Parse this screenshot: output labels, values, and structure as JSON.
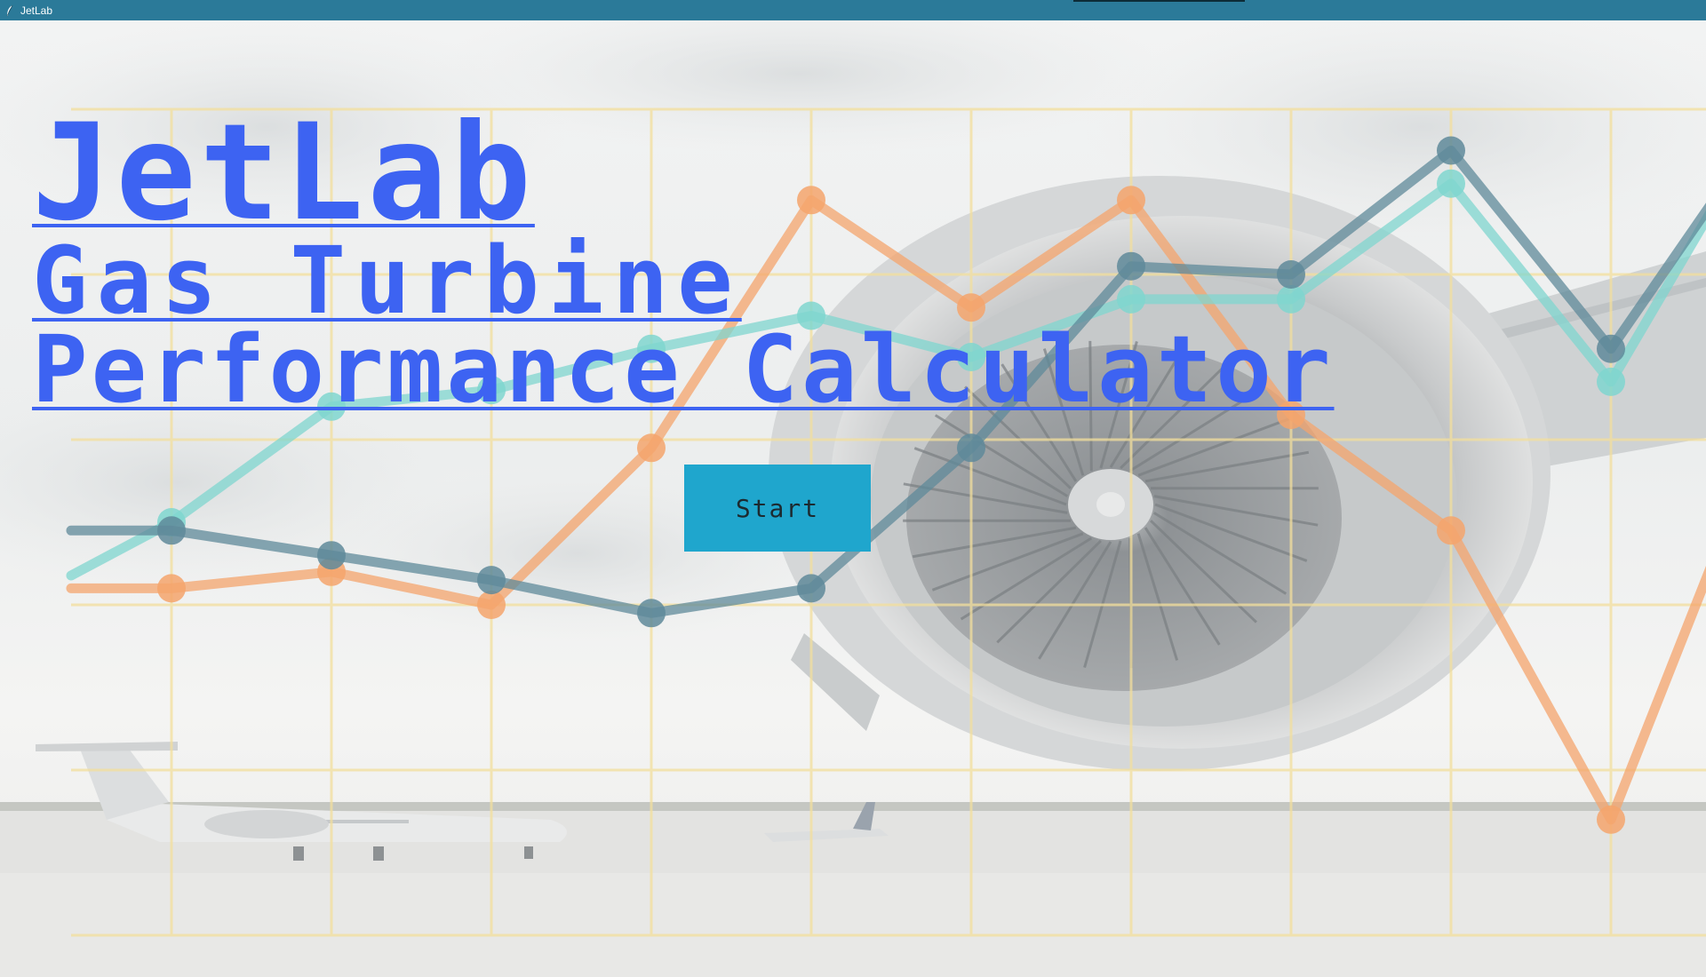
{
  "window": {
    "title": "JetLab"
  },
  "hero": {
    "title": "JetLab",
    "subtitle_line1": "Gas Turbine",
    "subtitle_line2": "Performance Calculator"
  },
  "start_button": {
    "label": "Start"
  },
  "background": {
    "image": "faded photo of jet engine and aircraft on airport apron",
    "decorative_chart": {
      "type": "line",
      "grid": true,
      "series": [
        {
          "color": "#f4a46c",
          "values": [
            4.2,
            4.4,
            4.0,
            5.9,
            8.9,
            7.6,
            8.9,
            6.3,
            4.9,
            1.4,
            6.3,
            4.7
          ]
        },
        {
          "color": "#7fd6cf",
          "values": [
            5.0,
            6.4,
            6.6,
            7.1,
            7.5,
            7.0,
            7.7,
            7.7,
            9.1,
            6.7,
            10.0,
            9.9
          ]
        },
        {
          "color": "#5f8a9a",
          "values": [
            4.9,
            4.6,
            4.3,
            3.9,
            4.2,
            5.9,
            8.1,
            8.0,
            9.5,
            7.1,
            9.9,
            9.3
          ]
        }
      ]
    }
  },
  "colors": {
    "titlebar": "#2b7a99",
    "title_text": "#3d63f2",
    "start_button": "#1fa6cd"
  }
}
